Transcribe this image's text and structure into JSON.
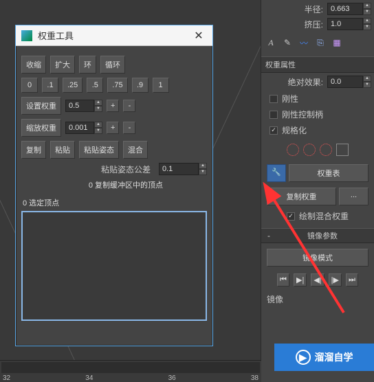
{
  "header": {
    "radius_label": "半径:",
    "radius_value": "0.663",
    "extrude_label": "挤压:",
    "extrude_value": "1.0"
  },
  "weight_props": {
    "title": "权重属性",
    "abs_effect_label": "绝对效果:",
    "abs_effect_value": "0.0",
    "rigid": "刚性",
    "rigid_handles": "刚性控制柄",
    "normalize": "规格化"
  },
  "tools": {
    "weight_table": "权重表",
    "copy_weight": "复制权重",
    "more": "...",
    "draw_mix": "绘制混合权重"
  },
  "mirror": {
    "section": "镜像参数",
    "mode": "镜像模式",
    "footer_label": "镜像"
  },
  "dialog": {
    "title": "权重工具",
    "shrink": "收缩",
    "grow": "扩大",
    "ring": "环",
    "loop": "循环",
    "vals": [
      "0",
      ".1",
      ".25",
      ".5",
      ".75",
      ".9",
      "1"
    ],
    "set_weight": "设置权重",
    "set_weight_val": "0.5",
    "scale_weight": "缩放权重",
    "scale_weight_val": "0.001",
    "plus": "+",
    "minus": "-",
    "copy": "复制",
    "paste": "粘贴",
    "paste_pose": "粘贴姿态",
    "mix": "混合",
    "paste_tol_label": "粘贴姿态公差",
    "paste_tol_val": "0.1",
    "buffer_note": "0 复制缓冲区中的顶点",
    "selected_verts": "0 选定顶点"
  },
  "timeline": {
    "ticks": [
      "32",
      "34",
      "36",
      "38"
    ]
  },
  "watermark": "溜溜自学"
}
